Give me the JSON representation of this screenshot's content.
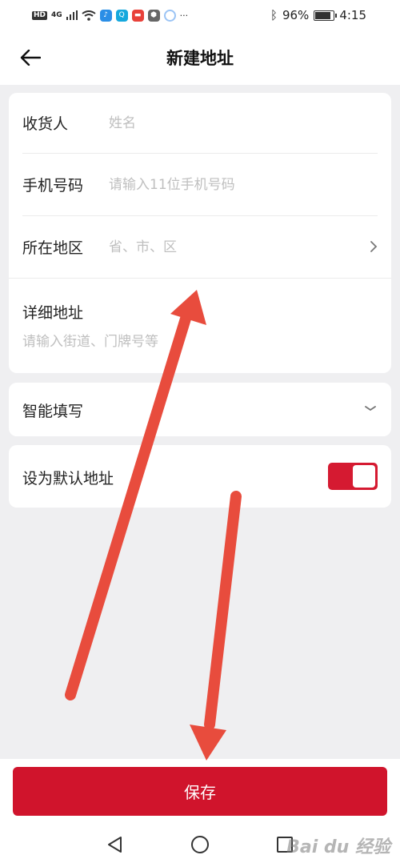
{
  "status_bar": {
    "hd": "HD",
    "network": "4G",
    "battery_percent": "96%",
    "time": "4:15",
    "more": "···"
  },
  "header": {
    "title": "新建地址"
  },
  "form": {
    "recipient_label": "收货人",
    "recipient_placeholder": "姓名",
    "phone_label": "手机号码",
    "phone_placeholder": "请输入11位手机号码",
    "region_label": "所在地区",
    "region_placeholder": "省、市、区",
    "address_label": "详细地址",
    "address_placeholder": "请输入街道、门牌号等"
  },
  "smart_fill": {
    "label": "智能填写"
  },
  "default_address": {
    "label": "设为默认地址",
    "enabled": true
  },
  "save": {
    "label": "保存"
  },
  "watermark": {
    "text": "Bai du 经验"
  },
  "colors": {
    "accent": "#d0142c",
    "background": "#efeff1",
    "placeholder": "#bfbfbf",
    "annotation": "#e84c3d"
  },
  "icons": {
    "back": "arrow-left-icon",
    "region_chevron": "chevron-right-icon",
    "smart_chevron": "chevron-down-icon",
    "nav_back": "triangle-back-icon",
    "nav_home": "circle-home-icon",
    "nav_recent": "square-recent-icon"
  }
}
